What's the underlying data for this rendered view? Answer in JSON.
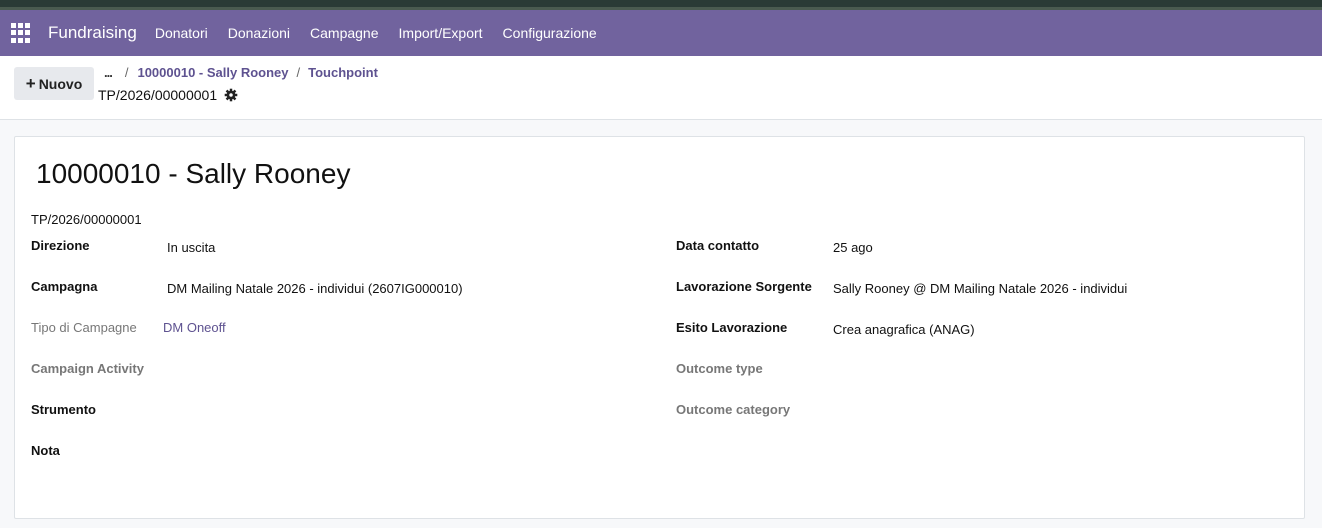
{
  "navbar": {
    "brand": "Fundraising",
    "items": [
      "Donatori",
      "Donazioni",
      "Campagne",
      "Import/Export",
      "Configurazione"
    ]
  },
  "controls": {
    "new_label": "Nuovo",
    "breadcrumb": {
      "ellipsis": "...",
      "items": [
        "10000010 - Sally Rooney",
        "Touchpoint"
      ]
    },
    "record_ref": "TP/2026/00000001"
  },
  "record": {
    "title": "10000010 - Sally Rooney",
    "code": "TP/2026/00000001",
    "left_fields": [
      {
        "label": "Direzione",
        "value": "In uscita"
      },
      {
        "label": "Campagna",
        "value": "DM Mailing Natale 2026 -  individui (2607IG000010)"
      },
      {
        "label": "Tipo di Campagne",
        "value": "DM Oneoff"
      },
      {
        "label": "Campaign Activity",
        "value": ""
      },
      {
        "label": "Strumento",
        "value": ""
      },
      {
        "label": "Nota",
        "value": ""
      }
    ],
    "right_fields": [
      {
        "label": "Data contatto",
        "value": "25 ago"
      },
      {
        "label": "Lavorazione Sorgente",
        "value": "Sally Rooney  @ DM Mailing Natale 2026 -  individui"
      },
      {
        "label": "Esito Lavorazione",
        "value": "Crea anagrafica (ANAG)"
      },
      {
        "label": "Outcome type",
        "value": ""
      },
      {
        "label": "Outcome category",
        "value": ""
      }
    ]
  },
  "colors": {
    "navbar": "#71639e",
    "link": "#5e5290"
  }
}
